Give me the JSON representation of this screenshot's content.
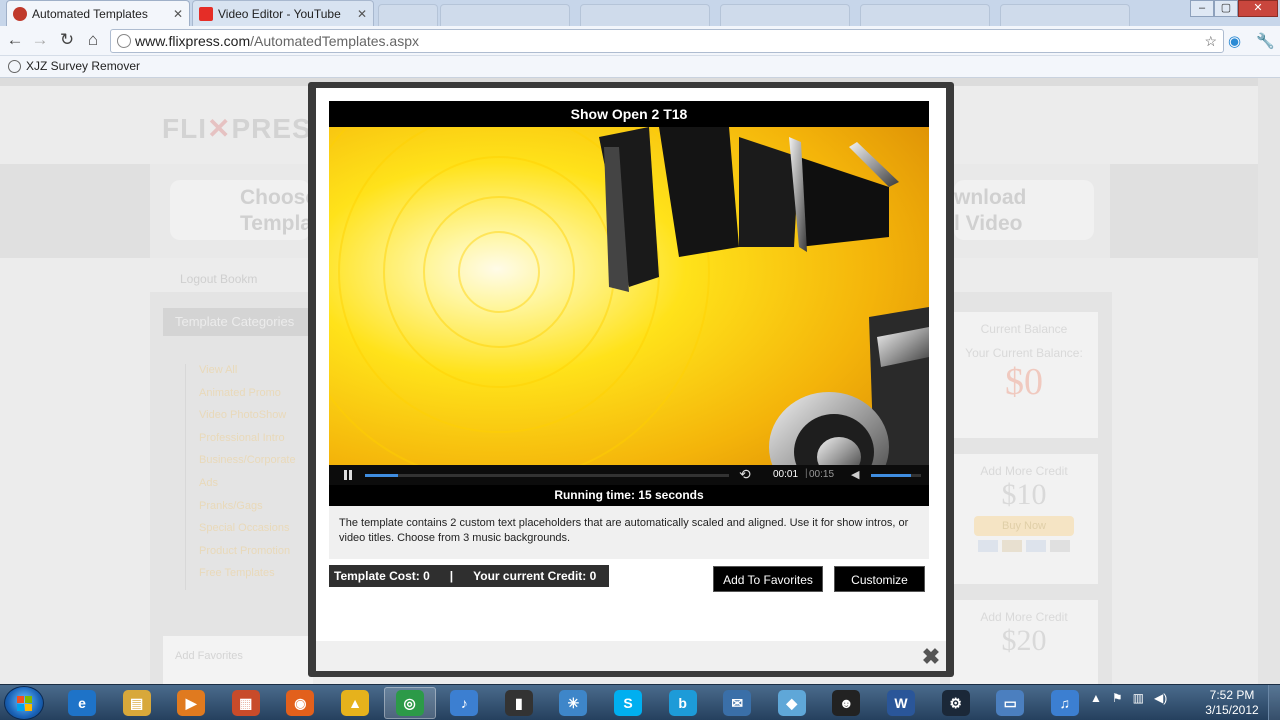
{
  "browser": {
    "tabs": [
      {
        "label": "Automated Templates",
        "favicon_color": "#c0392b",
        "active": true
      },
      {
        "label": "Video Editor - YouTube",
        "favicon_color": "#e52d27",
        "active": false
      }
    ],
    "url_host": "www.flixpress.com",
    "url_path": "/AutomatedTemplates.aspx",
    "bookmarks": [
      {
        "label": "XJZ Survey Remover"
      }
    ]
  },
  "background_page": {
    "logo_prefix": "FLI",
    "logo_suffix": "PRESS",
    "step_left": "Choose\nTempla",
    "step_right": "wnload\nl Video",
    "login_text": "Logout    Bookm",
    "categories_title": "Template Categories",
    "categories": [
      "View All",
      "Animated Promo",
      "Video PhotoShow",
      "Professional Intro",
      "Business/Corporate",
      "Ads",
      "Pranks/Gags",
      "Special Occasions",
      "Product Promotion",
      "Free Templates"
    ],
    "footer_box": "Add Favorites",
    "credit_box": {
      "title": "Current Balance",
      "subtitle": "Your Current Balance:",
      "amount": "$0"
    },
    "add_credit_10": {
      "title": "Add More Credit",
      "amount": "$10",
      "buy": "Buy Now"
    },
    "add_credit_20": {
      "title": "Add More Credit",
      "amount": "$20"
    }
  },
  "modal": {
    "video_title": "Show Open 2 T18",
    "current_time": "00:01",
    "total_time": "00:15",
    "progress_fraction": 0.09,
    "volume_fraction": 0.8,
    "running_time": "Running time: 15 seconds",
    "description": "The template contains 2 custom text placeholders that are automatically scaled and aligned. Use it for show intros, or video titles. Choose from 3 music backgrounds.",
    "template_cost": "Template Cost: 0",
    "separator": "|",
    "current_credit": "Your current Credit: 0",
    "add_favorites_label": "Add To Favorites",
    "customize_label": "Customize",
    "close_glyph": "✖"
  },
  "taskbar": {
    "apps": [
      {
        "name": "internet-explorer",
        "glyph": "e",
        "color": "#1e73c8"
      },
      {
        "name": "file-explorer",
        "glyph": "▤",
        "color": "#d8a83a"
      },
      {
        "name": "media-player",
        "glyph": "▶",
        "color": "#e07a1f"
      },
      {
        "name": "control-panel",
        "glyph": "▦",
        "color": "#c84b2a"
      },
      {
        "name": "firefox",
        "glyph": "◉",
        "color": "#e2601c"
      },
      {
        "name": "shapes-app",
        "glyph": "▲",
        "color": "#e6b21c"
      },
      {
        "name": "chrome",
        "glyph": "◎",
        "color": "#2c9a48"
      },
      {
        "name": "itunes",
        "glyph": "♪",
        "color": "#3c7fd1"
      },
      {
        "name": "phone-app",
        "glyph": "▮",
        "color": "#333333"
      },
      {
        "name": "safari",
        "glyph": "✳",
        "color": "#3e86c9"
      },
      {
        "name": "skype",
        "glyph": "S",
        "color": "#00aff0"
      },
      {
        "name": "blurb",
        "glyph": "b",
        "color": "#1d9bd8"
      },
      {
        "name": "thunderbird",
        "glyph": "✉",
        "color": "#3a6fa8"
      },
      {
        "name": "notes-app",
        "glyph": "◆",
        "color": "#5fa7d8"
      },
      {
        "name": "mascot-app",
        "glyph": "☻",
        "color": "#222222"
      },
      {
        "name": "word",
        "glyph": "W",
        "color": "#2a5699"
      },
      {
        "name": "steam",
        "glyph": "⚙",
        "color": "#1b2838"
      },
      {
        "name": "remote-desktop",
        "glyph": "▭",
        "color": "#4b7fbf"
      },
      {
        "name": "itunes-2",
        "glyph": "♫",
        "color": "#3c7fd1"
      }
    ],
    "time": "7:52 PM",
    "date": "3/15/2012"
  }
}
